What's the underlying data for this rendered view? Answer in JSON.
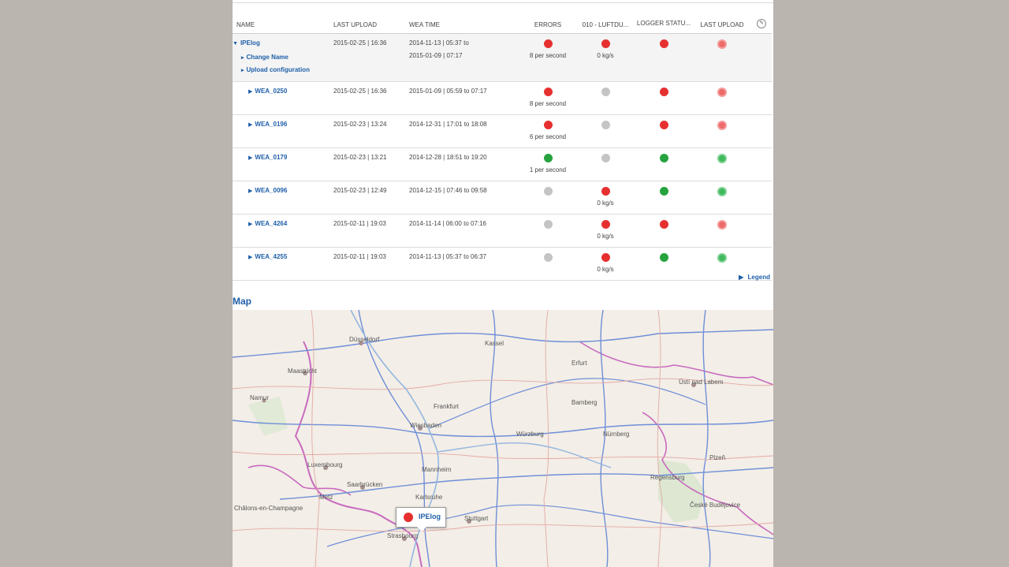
{
  "table": {
    "headers": [
      "Name",
      "Last Upload",
      "WEA time",
      "Errors",
      "010 - Luftdu...",
      "Logger Statu...",
      "Last Upload"
    ],
    "group": {
      "name": "IPElog",
      "last_upload": "2015-02-25 | 16:36",
      "wea_time_line1": "2014-11-13 | 05:37 to",
      "wea_time_line2": "2015-01-09 | 07:17",
      "errors_status": "red",
      "errors_text": "8 per second",
      "luft_status": "red",
      "luft_text": "0 kg/s",
      "logger_status": "red",
      "upload_status": "red",
      "actions": [
        "Change Name",
        "Upload configuration"
      ]
    },
    "rows": [
      {
        "name": "WEA_0250",
        "last_upload": "2015-02-25 | 16:36",
        "wea_time": "2015-01-09 | 05:59 to 07:17",
        "errors_status": "red",
        "errors_text": "8 per second",
        "luft_status": "grey",
        "luft_text": "",
        "logger_status": "red",
        "upload_status": "red"
      },
      {
        "name": "WEA_0196",
        "last_upload": "2015-02-23 | 13:24",
        "wea_time": "2014-12-31 | 17:01 to 18:08",
        "errors_status": "red",
        "errors_text": "6 per second",
        "luft_status": "grey",
        "luft_text": "",
        "logger_status": "red",
        "upload_status": "red"
      },
      {
        "name": "WEA_0179",
        "last_upload": "2015-02-23 | 13:21",
        "wea_time": "2014-12-28 | 18:51 to 19:20",
        "errors_status": "green",
        "errors_text": "1 per second",
        "luft_status": "grey",
        "luft_text": "",
        "logger_status": "green",
        "upload_status": "green"
      },
      {
        "name": "WEA_0096",
        "last_upload": "2015-02-23 | 12:49",
        "wea_time": "2014-12-15 | 07:46 to 09:58",
        "errors_status": "grey",
        "errors_text": "",
        "luft_status": "red",
        "luft_text": "0 kg/s",
        "logger_status": "green",
        "upload_status": "green"
      },
      {
        "name": "WEA_4264",
        "last_upload": "2015-02-11 | 19:03",
        "wea_time": "2014-11-14 | 06:00 to 07:16",
        "errors_status": "grey",
        "errors_text": "",
        "luft_status": "red",
        "luft_text": "0 kg/s",
        "logger_status": "red",
        "upload_status": "red"
      },
      {
        "name": "WEA_4255",
        "last_upload": "2015-02-11 | 19:03",
        "wea_time": "2014-11-13 | 05:37 to 06:37",
        "errors_status": "grey",
        "errors_text": "",
        "luft_status": "red",
        "luft_text": "0 kg/s",
        "logger_status": "green",
        "upload_status": "green"
      }
    ]
  },
  "legend_label": "Legend",
  "map": {
    "title": "Map",
    "marker_label": "IPElog",
    "cities": [
      "Düsseldorf",
      "Maastricht",
      "Namur",
      "Wiesbaden",
      "Luxembourg",
      "Saarbrücken",
      "Stuttgart",
      "Strasbourg",
      "Châlons-en-Champagne",
      "Metz",
      "Ústí nad Labem",
      "Nürnberg",
      "Würzburg",
      "Frankfurt",
      "Mannheim",
      "Karlsruhe",
      "Erfurt",
      "Bamberg",
      "Regensburg",
      "Plzeň",
      "České Budějovice",
      "Kassel"
    ]
  },
  "colors": {
    "red": "#e63030",
    "green": "#26a33f",
    "grey": "#c4c4c4",
    "link": "#1f5fa8"
  },
  "icons": {
    "settings": "settings-icon",
    "expand": "triangle-down-icon",
    "collapse": "triangle-right-icon",
    "status": "status-dot-icon",
    "upload": "upload-status-icon"
  }
}
